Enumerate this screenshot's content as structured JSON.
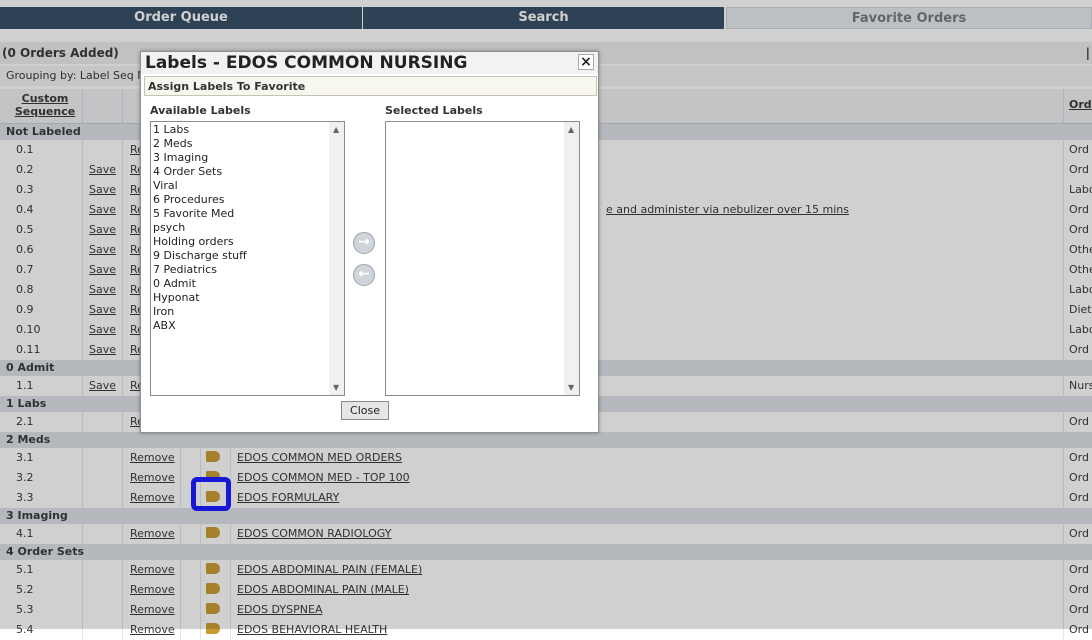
{
  "tabs": [
    "Order Queue",
    "Search",
    "Favorite Orders"
  ],
  "header": {
    "orders_added": "(0 Orders Added)",
    "grouping": "Grouping by: Label Seq N",
    "col_custom_sequence": "Custom Sequence",
    "col_order": "Ord",
    "right_mark": "|"
  },
  "groups": [
    {
      "label": "Not Labeled",
      "rows": [
        {
          "seq": "0.1",
          "save": "",
          "rm": "Re",
          "name": "",
          "long": "",
          "type": "Ord"
        },
        {
          "seq": "0.2",
          "save": "Save",
          "rm": "Re",
          "name": "",
          "long": "",
          "type": "Ord"
        },
        {
          "seq": "0.3",
          "save": "Save",
          "rm": "Re",
          "name": "",
          "long": "",
          "type": "Labo"
        },
        {
          "seq": "0.4",
          "save": "Save",
          "rm": "Re",
          "name": "",
          "long": "e and administer via nebulizer over 15 mins",
          "type": "Ord"
        },
        {
          "seq": "0.5",
          "save": "Save",
          "rm": "Re",
          "name": "",
          "long": "",
          "type": "Ord"
        },
        {
          "seq": "0.6",
          "save": "Save",
          "rm": "Re",
          "name": "",
          "long": "",
          "type": "Othe"
        },
        {
          "seq": "0.7",
          "save": "Save",
          "rm": "Re",
          "name": "",
          "long": "",
          "type": "Othe"
        },
        {
          "seq": "0.8",
          "save": "Save",
          "rm": "Re",
          "name": "",
          "long": "",
          "type": "Labo"
        },
        {
          "seq": "0.9",
          "save": "Save",
          "rm": "Re",
          "name": "",
          "long": "",
          "type": "Dieta"
        },
        {
          "seq": "0.10",
          "save": "Save",
          "rm": "Re",
          "name": "",
          "long": "",
          "type": "Labo"
        },
        {
          "seq": "0.11",
          "save": "Save",
          "rm": "Re",
          "name": "",
          "long": "",
          "type": "Ord"
        }
      ]
    },
    {
      "label": "0 Admit",
      "rows": [
        {
          "seq": "1.1",
          "save": "Save",
          "rm": "Re",
          "name": "",
          "long": "",
          "type": "Nurs"
        }
      ]
    },
    {
      "label": "1 Labs",
      "rows": [
        {
          "seq": "2.1",
          "save": "",
          "rm": "Re",
          "name": "",
          "long": "",
          "type": "Ord"
        }
      ]
    },
    {
      "label": "2 Meds",
      "rows": [
        {
          "seq": "3.1",
          "save": "",
          "rm": "Remove",
          "name": "EDOS COMMON MED ORDERS",
          "long": "",
          "type": "Ord"
        },
        {
          "seq": "3.2",
          "save": "",
          "rm": "Remove",
          "name": "EDOS COMMON MED - TOP 100",
          "long": "",
          "type": "Ord"
        },
        {
          "seq": "3.3",
          "save": "",
          "rm": "Remove",
          "name": "EDOS FORMULARY",
          "long": "",
          "type": "Ord"
        }
      ]
    },
    {
      "label": "3 Imaging",
      "rows": [
        {
          "seq": "4.1",
          "save": "",
          "rm": "Remove",
          "name": "EDOS COMMON RADIOLOGY",
          "long": "",
          "type": "Ord"
        }
      ]
    },
    {
      "label": "4 Order Sets",
      "rows": [
        {
          "seq": "5.1",
          "save": "",
          "rm": "Remove",
          "name": "EDOS ABDOMINAL PAIN (FEMALE)",
          "long": "",
          "type": "Ord"
        },
        {
          "seq": "5.2",
          "save": "",
          "rm": "Remove",
          "name": "EDOS ABDOMINAL PAIN (MALE)",
          "long": "",
          "type": "Ord"
        },
        {
          "seq": "5.3",
          "save": "",
          "rm": "Remove",
          "name": "EDOS DYSPNEA",
          "long": "",
          "type": "Ord"
        },
        {
          "seq": "5.4",
          "save": "",
          "rm": "Remove",
          "name": "EDOS BEHAVIORAL HEALTH",
          "long": "",
          "type": "Ord"
        }
      ]
    }
  ],
  "dialog": {
    "title": "Labels - EDOS COMMON NURSING",
    "close_glyph": "×",
    "subtitle": "Assign Labels To Favorite",
    "available_header": "Available Labels",
    "selected_header": "Selected Labels",
    "available": [
      "1 Labs",
      "2 Meds",
      "3 Imaging",
      "4 Order Sets",
      "Viral",
      "6 Procedures",
      "5 Favorite Med",
      "psych",
      "Holding orders",
      "9 Discharge stuff",
      "7 Pediatrics",
      "0 Admit",
      "Hyponat",
      "Iron",
      "ABX"
    ],
    "selected": [],
    "move_right_glyph": "→",
    "move_left_glyph": "←",
    "close_button": "Close"
  },
  "colors": {
    "tab_dark": "#2f4a61",
    "group_bg": "#dde2e8",
    "tag": "#c99a2e",
    "highlight": "#1717d6"
  }
}
